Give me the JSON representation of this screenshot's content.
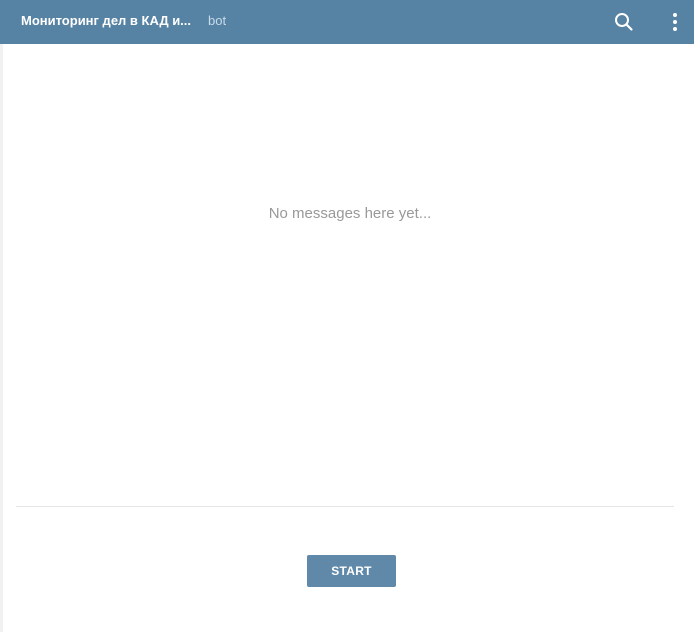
{
  "header": {
    "title": "Мониторинг дел в КАД и...",
    "subtitle": "bot",
    "background_color": "#5682a3",
    "search_icon": "search-icon",
    "menu_icon": "more-vertical-icon"
  },
  "chat": {
    "empty_message": "No messages here yet..."
  },
  "composer": {
    "start_label": "START",
    "button_color": "#6089a9"
  }
}
